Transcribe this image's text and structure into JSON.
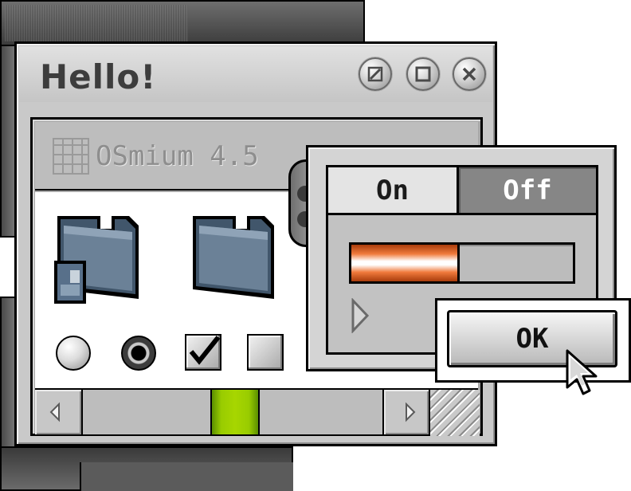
{
  "window": {
    "title": "Hello!",
    "controls": [
      "collapse-icon",
      "zoom-icon",
      "close-icon"
    ]
  },
  "header": {
    "text": "OSmium 4.5",
    "icon": "grid-icon"
  },
  "content": {
    "folders": [
      "folder-with-document-icon",
      "folder-icon"
    ],
    "radios": [
      {
        "name": "radio-unselected",
        "checked": false
      },
      {
        "name": "radio-selected",
        "checked": true
      }
    ],
    "checkboxes": [
      {
        "name": "checkbox-checked",
        "checked": true
      },
      {
        "name": "checkbox-unchecked",
        "checked": false
      }
    ]
  },
  "scrollbar": {
    "left_icon": "arrow-left-icon",
    "right_icon": "arrow-right-icon",
    "thumb_color": "#99cc00"
  },
  "drawer": {
    "segmented": {
      "on_label": "On",
      "off_label": "Off",
      "selected": "On"
    },
    "progress": 0.49,
    "progress_color": "#f07a3c",
    "disclosure_icon": "disclosure-triangle-icon"
  },
  "dialog": {
    "ok_label": "OK"
  },
  "cursor": "pointer-cursor-icon"
}
